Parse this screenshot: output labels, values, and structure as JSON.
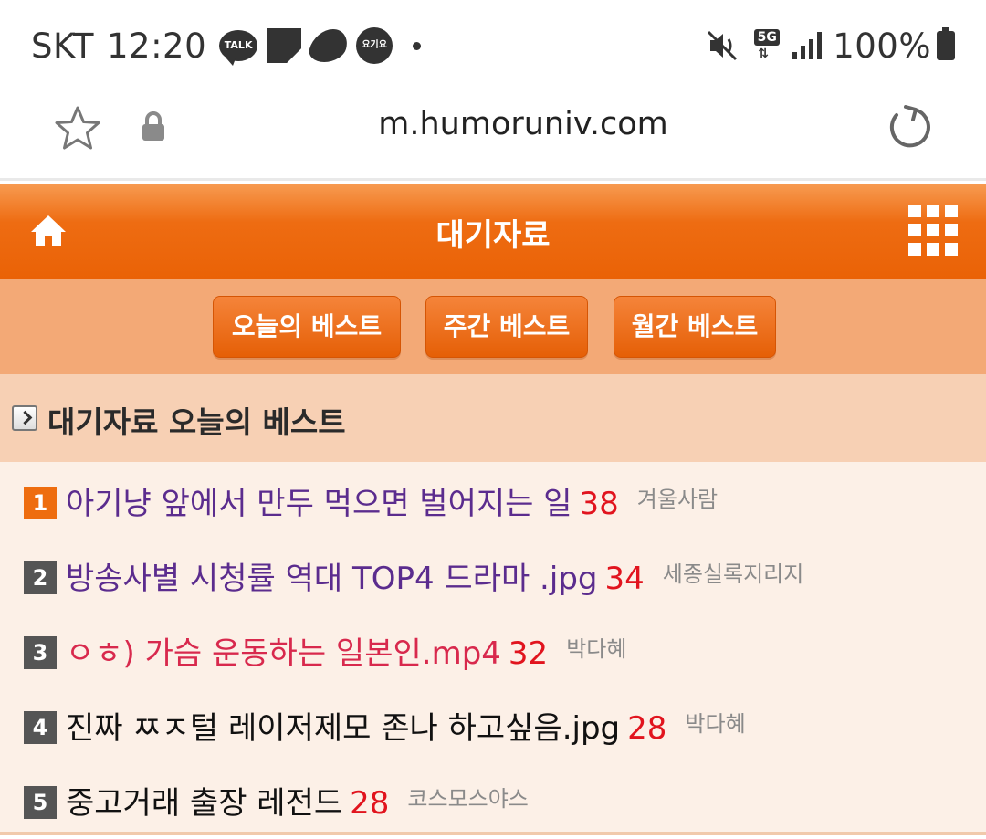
{
  "status_bar": {
    "carrier": "SKT",
    "time": "12:20",
    "notification_icons": [
      "kakaotalk-icon",
      "memo-icon",
      "swirl-icon",
      "yogiyo-icon"
    ],
    "talk_label": "TALK",
    "yogiyo_label": "요기요",
    "network": "5G",
    "battery": "100%"
  },
  "browser": {
    "url": "m.humoruniv.com"
  },
  "header": {
    "title": "대기자료"
  },
  "tabs": [
    {
      "label": "오늘의 베스트"
    },
    {
      "label": "주간 베스트"
    },
    {
      "label": "월간 베스트"
    }
  ],
  "section": {
    "title": "대기자료 오늘의 베스트"
  },
  "colors": {
    "accent": "#ea6206",
    "title_purple": "#5b2c8e",
    "title_red": "#d8294d",
    "count_red": "#e1141e"
  },
  "posts": [
    {
      "rank": "1",
      "title": "아기냥 앞에서 만두 먹으면 벌어지는 일",
      "count": "38",
      "author": "겨울사람"
    },
    {
      "rank": "2",
      "title": "방송사별 시청률 역대 TOP4 드라마 .jpg",
      "count": "34",
      "author": "세종실록지리지"
    },
    {
      "rank": "3",
      "title": "ㅇㅎ) 가슴 운동하는 일본인.mp4",
      "count": "32",
      "author": "박다혜"
    },
    {
      "rank": "4",
      "title": "진짜 ㅉㅈ털 레이저제모 존나 하고싶음.jpg",
      "count": "28",
      "author": "박다혜"
    },
    {
      "rank": "5",
      "title": "중고거래 출장 레전드",
      "count": "28",
      "author": "코스모스야스"
    }
  ]
}
